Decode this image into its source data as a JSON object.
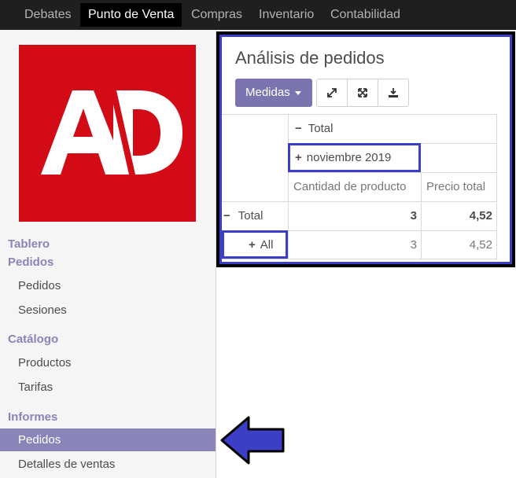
{
  "nav": {
    "items": [
      "Debates",
      "Punto de Venta",
      "Compras",
      "Inventario",
      "Contabilidad"
    ],
    "active": "Punto de Venta"
  },
  "logo": {
    "text": "AD",
    "color": "#d30b16"
  },
  "sidebar": {
    "tablero": "Tablero",
    "pedidos_header": "Pedidos",
    "pedidos_items": [
      "Pedidos",
      "Sesiones"
    ],
    "catalogo_header": "Catálogo",
    "catalogo_items": [
      "Productos",
      "Tarifas"
    ],
    "informes_header": "Informes",
    "informes_items": [
      "Pedidos",
      "Detalles de ventas"
    ],
    "active_item": "Pedidos"
  },
  "main": {
    "title": "Análisis de pedidos",
    "medidas_label": "Medidas",
    "tools": [
      "expand-icon",
      "arrows-out-icon",
      "download-icon"
    ]
  },
  "pivot": {
    "col_header_total": "Total",
    "col_group": "noviembre 2019",
    "measures": [
      "Cantidad de producto",
      "Precio total"
    ],
    "rows": [
      {
        "label": "Total",
        "qty": "3",
        "price": "4,52"
      },
      {
        "label": "All",
        "qty": "3",
        "price": "4,52"
      }
    ]
  },
  "colors": {
    "accent": "#7a75ae",
    "highlight": "#3a3fc5",
    "sidebar_active": "#8a85b8"
  }
}
